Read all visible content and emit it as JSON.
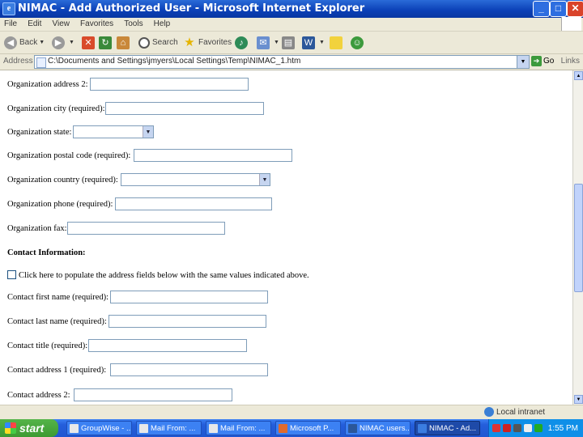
{
  "window": {
    "title": "NIMAC - Add Authorized User - Microsoft Internet Explorer",
    "app_icon": "e",
    "minimize": "_",
    "maximize": "□",
    "close": "✕"
  },
  "menu": [
    "File",
    "Edit",
    "View",
    "Favorites",
    "Tools",
    "Help"
  ],
  "toolbar": {
    "back": "Back",
    "search": "Search",
    "favorites": "Favorites"
  },
  "address": {
    "label": "Address",
    "url": "C:\\Documents and Settings\\jmyers\\Local Settings\\Temp\\NIMAC_1.htm",
    "go": "Go",
    "links": "Links"
  },
  "form": {
    "org_address_2": "Organization address 2:",
    "org_city": "Organization city (required):",
    "org_state": "Organization state:",
    "org_postal": "Organization postal code (required):",
    "org_country": "Organization country (required):",
    "org_phone": "Organization phone (required):",
    "org_fax": "Organization fax:",
    "contact_heading": "Contact Information:",
    "copy_address": "Click here to populate the address fields below with the same values indicated above.",
    "contact_first": "Contact first name (required):",
    "contact_last": "Contact last name (required):",
    "contact_title": "Contact title (required):",
    "contact_addr1": "Contact address 1 (required):",
    "contact_addr2": "Contact address 2:"
  },
  "status": {
    "zone": "Local intranet"
  },
  "taskbar": {
    "start": "start",
    "tasks": [
      "GroupWise - ...",
      "Mail From: ...",
      "Mail From: ...",
      "Microsoft P...",
      "NIMAC users...",
      "NIMAC - Ad..."
    ],
    "clock": "1:55 PM"
  },
  "colors": {
    "titlebar": "#0a3fb6",
    "chrome": "#ece9d8",
    "field_border": "#7f9db9",
    "taskbar": "#245edb",
    "start": "#3c9a31"
  }
}
